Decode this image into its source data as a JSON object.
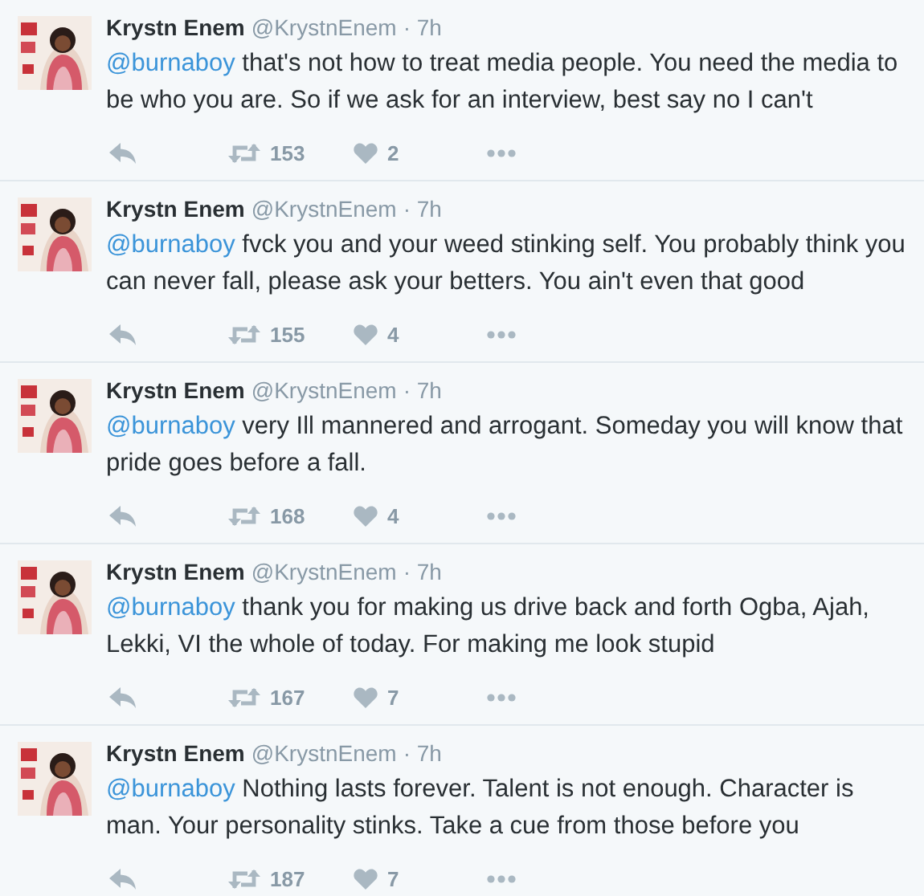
{
  "tweets": [
    {
      "name": "Krystn Enem",
      "handle": "@KrystnEnem",
      "time": "· 7h",
      "mention": "@burnaboy",
      "text": "that's not how to treat media people. You need the media to be who you are. So if we ask for an interview, best say no I can't",
      "retweets": "153",
      "likes": "2"
    },
    {
      "name": "Krystn Enem",
      "handle": "@KrystnEnem",
      "time": "· 7h",
      "mention": "@burnaboy",
      "text": "fvck you and your weed stinking self. You probably think you can never fall, please ask your betters. You ain't even that good",
      "retweets": "155",
      "likes": "4"
    },
    {
      "name": "Krystn Enem",
      "handle": "@KrystnEnem",
      "time": "· 7h",
      "mention": "@burnaboy",
      "text": "very Ill mannered and arrogant. Someday you will know that pride goes before a fall.",
      "retweets": "168",
      "likes": "4"
    },
    {
      "name": "Krystn Enem",
      "handle": "@KrystnEnem",
      "time": "· 7h",
      "mention": "@burnaboy",
      "text": "thank you for making us drive back and forth Ogba, Ajah, Lekki, VI the whole of today. For making me look stupid",
      "retweets": "167",
      "likes": "7"
    },
    {
      "name": "Krystn Enem",
      "handle": "@KrystnEnem",
      "time": "· 7h",
      "mention": "@burnaboy",
      "text": "Nothing lasts forever. Talent is not enough. Character is man. Your personality stinks. Take a cue from those before you",
      "retweets": "187",
      "likes": "7"
    }
  ]
}
